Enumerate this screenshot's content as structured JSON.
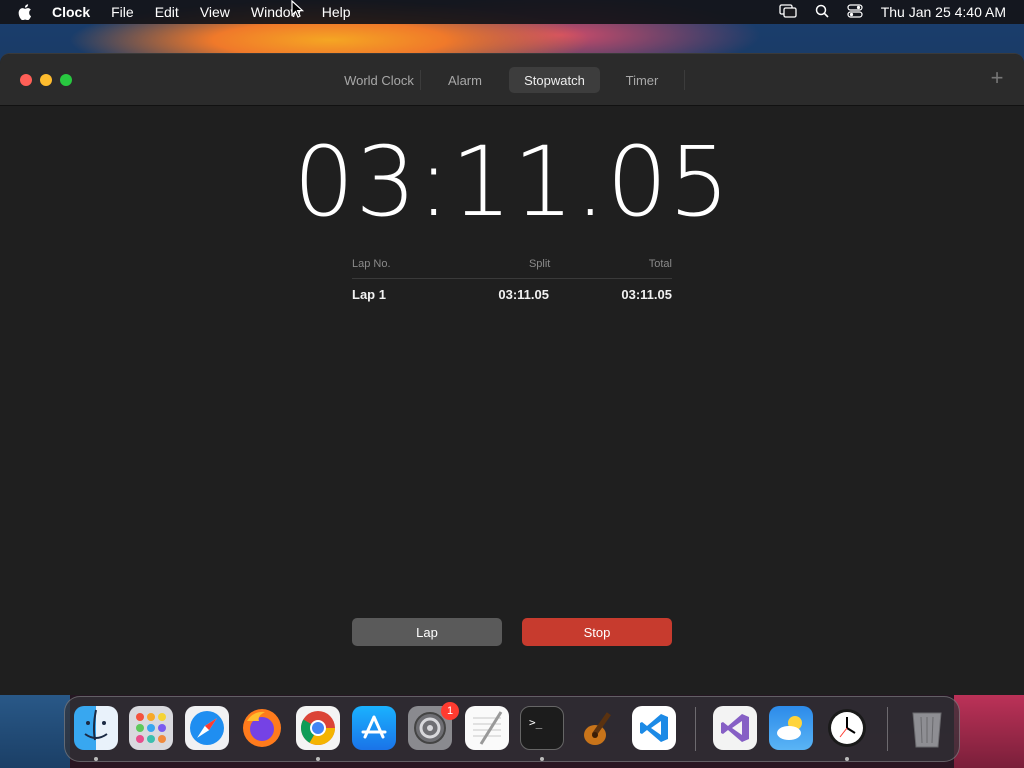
{
  "menubar": {
    "app_name": "Clock",
    "items": [
      "File",
      "Edit",
      "View",
      "Window",
      "Help"
    ],
    "datetime": "Thu Jan 25  4:40 AM"
  },
  "window": {
    "tabs": [
      {
        "label": "World Clock"
      },
      {
        "label": "Alarm"
      },
      {
        "label": "Stopwatch",
        "selected": true
      },
      {
        "label": "Timer"
      }
    ]
  },
  "stopwatch": {
    "elapsed": "03:11.05",
    "columns": [
      "Lap No.",
      "Split",
      "Total"
    ],
    "laps": [
      {
        "lap": "Lap 1",
        "split": "03:11.05",
        "total": "03:11.05"
      }
    ],
    "lap_button": "Lap",
    "stop_button": "Stop"
  },
  "dock": {
    "apps": [
      "finder-icon",
      "launchpad-icon",
      "safari-icon",
      "firefox-icon",
      "chrome-icon",
      "app-store-icon",
      "system-preferences-icon",
      "textedit-icon",
      "terminal-icon",
      "garageband-icon",
      "vscode-icon",
      "visual-studio-icon",
      "weather-icon",
      "clock-icon",
      "trash-icon"
    ],
    "settings_badge": "1"
  },
  "colors": {
    "stop": "#c73b2e",
    "lap": "#5a5a5a",
    "window_bg": "#1f1f1f"
  }
}
